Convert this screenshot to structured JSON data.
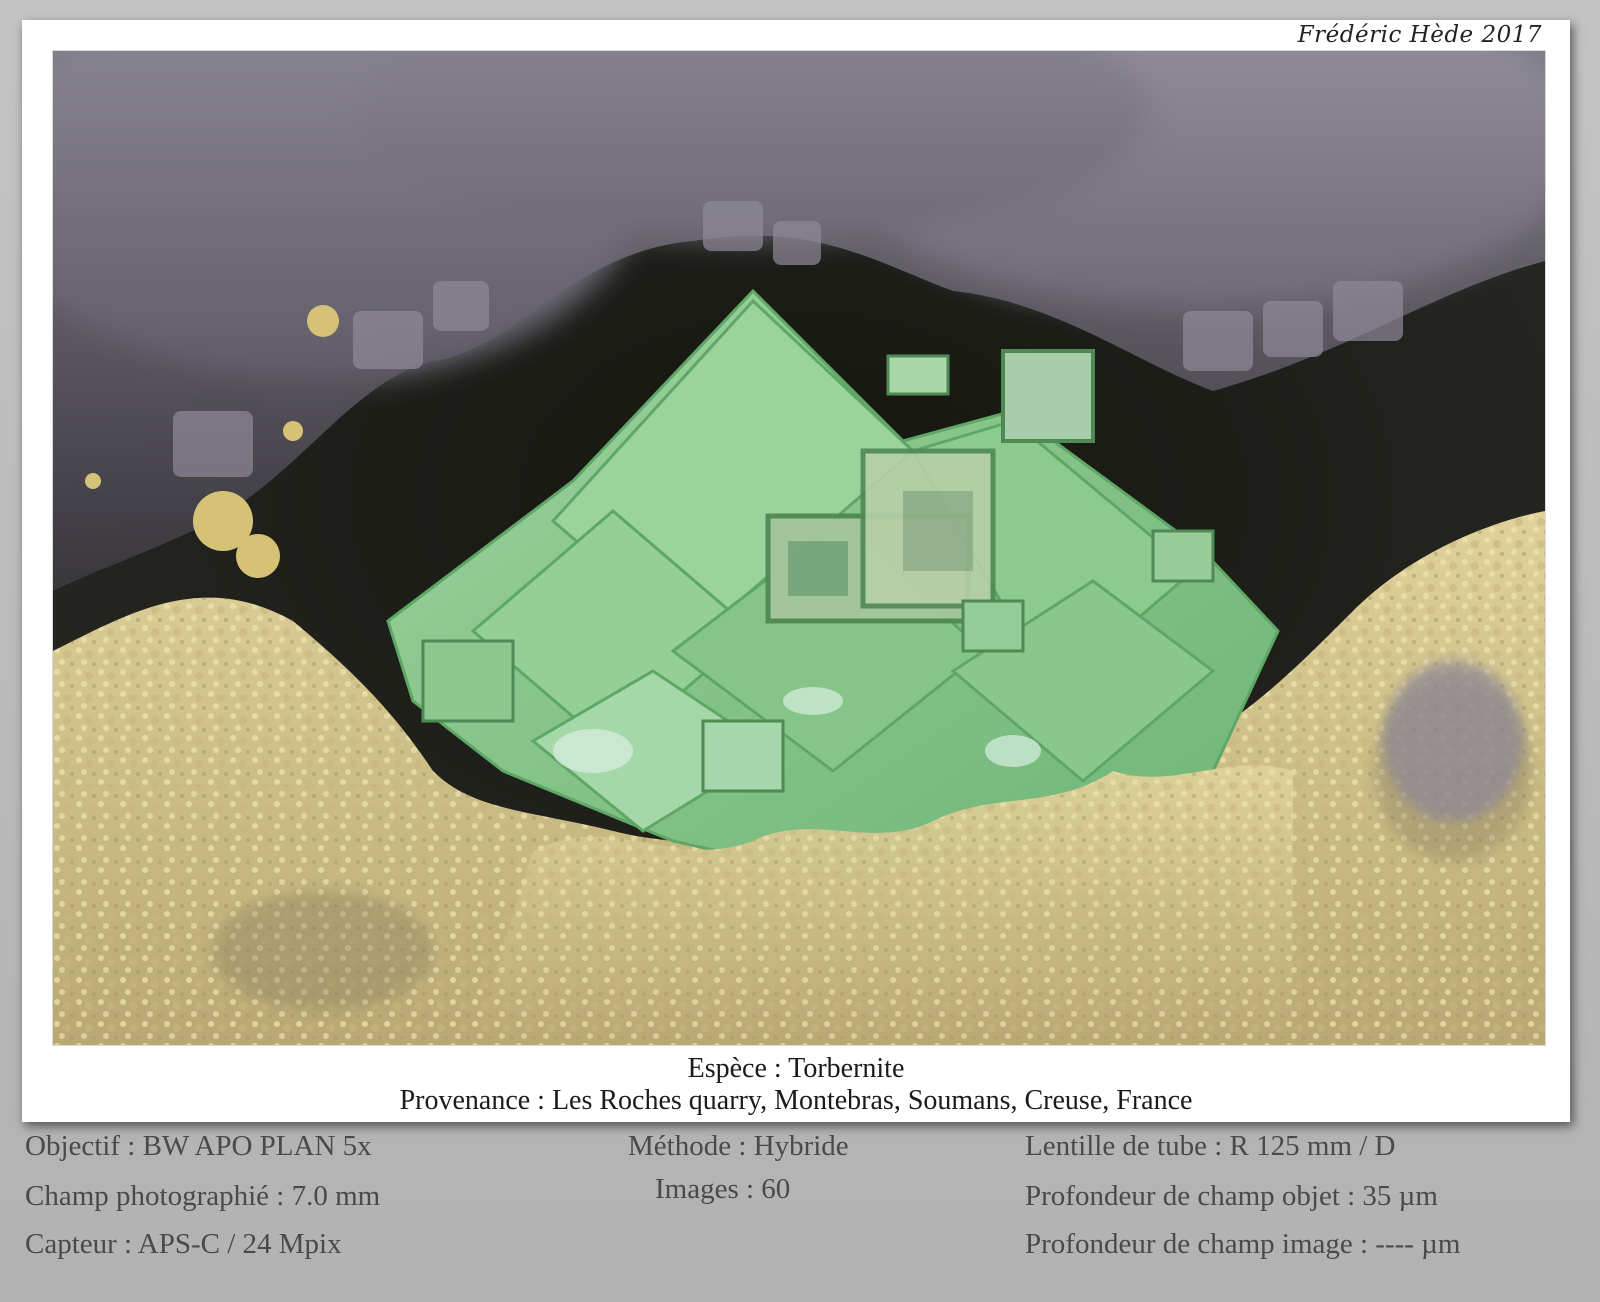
{
  "credit": "Frédéric Hède 2017",
  "caption": {
    "species": "Espèce : Torbernite",
    "origin": "Provenance : Les Roches quarry, Montebras, Soumans, Creuse,  France"
  },
  "specs": {
    "objective": "Objectif : BW APO PLAN 5x",
    "field": "Champ photographié : 7.0 mm",
    "sensor": "Capteur : APS-C / 24 Mpix",
    "method": "Méthode : Hybride",
    "images": "Images : 60",
    "tube_lens": "Lentille de tube : R 125 mm / D",
    "object_dof": "Profondeur de champ objet : 35 µm",
    "image_dof": "Profondeur de champ image : ---- µm"
  },
  "photo": {
    "subject": "green torbernite crystal cluster on quartz and yellow matrix",
    "colors": {
      "crystal": "#8cc58f",
      "crystal_edge": "#5fa765",
      "matrix": "#d8c88e",
      "quartz": "#6d6875",
      "background": "#1c1c1a"
    }
  }
}
